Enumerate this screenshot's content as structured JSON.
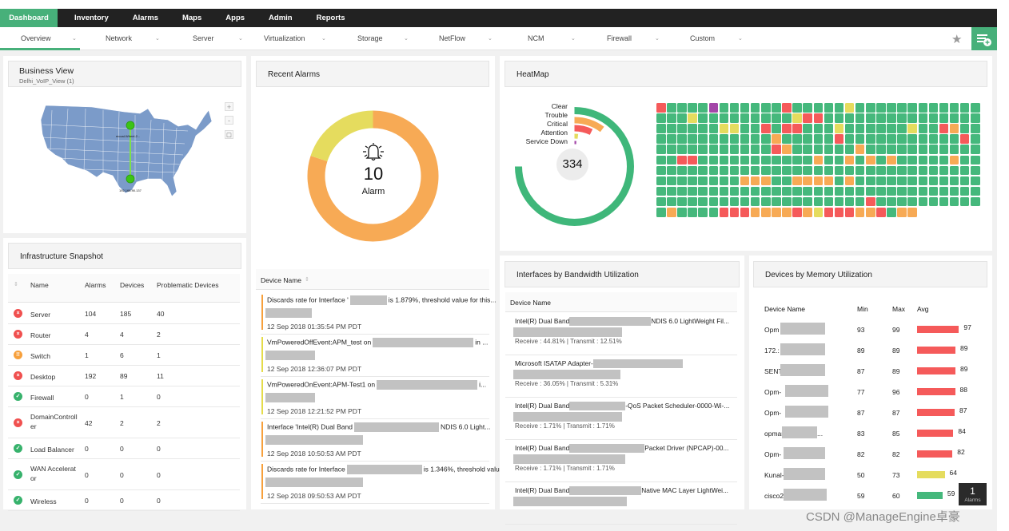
{
  "topnav": {
    "tabs": [
      {
        "label": "Dashboard",
        "active": true
      },
      {
        "label": "Inventory"
      },
      {
        "label": "Alarms"
      },
      {
        "label": "Maps"
      },
      {
        "label": "Apps"
      },
      {
        "label": "Admin"
      },
      {
        "label": "Reports"
      }
    ]
  },
  "subnav": {
    "items": [
      "Overview",
      "Network",
      "Server",
      "Virtualization",
      "Storage",
      "NetFlow",
      "NCM",
      "Firewall",
      "Custom"
    ],
    "active": "Overview",
    "star_icon": "star-icon",
    "add_widget_icon": "add-widget-icon"
  },
  "business_view": {
    "title": "Business View",
    "subtitle": "Delhi_VoIP_View (1)",
    "map_controls": [
      "+",
      "-",
      "□"
    ],
    "node_labels": [
      "mcoal-Wheel-2...",
      "192.168.90.137"
    ],
    "colors": {
      "map": "#7a9cc8",
      "node": "#3cc416",
      "link": "#7de04a"
    }
  },
  "infrastructure_snapshot": {
    "title": "Infrastructure Snapshot",
    "columns": [
      "Name",
      "Alarms",
      "Devices",
      "Problematic Devices"
    ],
    "rows": [
      {
        "status": "critical",
        "name": "Server",
        "alarms": "104",
        "devices": "185",
        "problematic": "40"
      },
      {
        "status": "critical",
        "name": "Router",
        "alarms": "4",
        "devices": "4",
        "problematic": "2"
      },
      {
        "status": "warning",
        "name": "Switch",
        "alarms": "1",
        "devices": "6",
        "problematic": "1"
      },
      {
        "status": "critical",
        "name": "Desktop",
        "alarms": "192",
        "devices": "89",
        "problematic": "11"
      },
      {
        "status": "ok",
        "name": "Firewall",
        "alarms": "0",
        "devices": "1",
        "problematic": "0"
      },
      {
        "status": "critical",
        "name": "DomainController",
        "alarms": "42",
        "devices": "2",
        "problematic": "2"
      },
      {
        "status": "ok",
        "name": "Load Balancer",
        "alarms": "0",
        "devices": "0",
        "problematic": "0"
      },
      {
        "status": "ok",
        "name": "WAN Accelerator",
        "alarms": "0",
        "devices": "0",
        "problematic": "0"
      },
      {
        "status": "ok",
        "name": "Wireless",
        "alarms": "0",
        "devices": "0",
        "problematic": "0"
      }
    ],
    "status_colors": {
      "critical": "#f0504f",
      "warning": "#f7a03c",
      "ok": "#37b26c"
    }
  },
  "recent_alarms": {
    "title": "Recent Alarms",
    "count": "10",
    "count_label": "Alarm",
    "donut": [
      {
        "severity": "Trouble",
        "value": 8,
        "color": "#f7aa55"
      },
      {
        "severity": "Attention",
        "value": 2,
        "color": "#e5dc5e"
      }
    ],
    "list_header": "Device Name",
    "items": [
      {
        "pre": "Discards rate for Interface '",
        "post": "is 1.879%, threshold value for this...",
        "time": "12 Sep 2018 01:35:54 PM PDT",
        "color": "#f7a03c"
      },
      {
        "pre": "VmPoweredOffEvent:APM_test on",
        "post": "in ...",
        "time": "12 Sep 2018 12:36:07 PM PDT",
        "color": "#e5dc4a"
      },
      {
        "pre": "VmPoweredOnEvent:APM-Test1 on",
        "post": "i...",
        "time": "12 Sep 2018 12:21:52 PM PDT",
        "color": "#e5dc4a"
      },
      {
        "pre": "Interface 'Intel(R) Dual Band",
        "post": "NDIS 6.0 Light...",
        "time": "12 Sep 2018 10:50:53 AM PDT",
        "color": "#f7a03c"
      },
      {
        "pre": "Discards rate for Interface",
        "post": "is 1.346%, threshold value for...",
        "time": "12 Sep 2018 09:50:53 AM PDT",
        "color": "#f7a03c"
      }
    ]
  },
  "heatmap": {
    "title": "HeatMap",
    "total": "334",
    "legend": [
      {
        "label": "Clear",
        "color": "#3fb77a"
      },
      {
        "label": "Trouble",
        "color": "#f7aa55"
      },
      {
        "label": "Critical",
        "color": "#f55a5a"
      },
      {
        "label": "Attention",
        "color": "#e5dc5e"
      },
      {
        "label": "Service Down",
        "color": "#a347a8"
      }
    ],
    "radial_fractions": {
      "Clear": 0.84,
      "Trouble": 0.085,
      "Critical": 0.06,
      "Attention": 0.015,
      "Service Down": 0.005
    },
    "grid_rows": [
      "RGGGGPGGGGGGRGGGGGYGGGGGGGGGGGG",
      "GGGYGGGGGGGGGYRRGGGGGGGGGGGGGGG",
      "GGGGGGYYGGRGRRGGGYGGGGGGYGGROGG",
      "GGGGGGGGGGGOGGGGGRGGGGGGGGGGGRG",
      "GGGGGGGGGGGROGGGGGGOGGGGGGGGGGG",
      "GGRRGGGGGGGGGGGOGGOGOGOGGGGGOGG",
      "GGGGGGGGGGGGGGGGGGGGGGGGGGGGGGG",
      "GGGGGGGGOOOGGOOOOGOGGGGGGGGGGGG",
      "GGGGGGGGGGGGGGGGGGGGGGGGGGGGGGG",
      "GGGGGGGGGGGGGGGGGGGGRGGGGGGGGGG",
      "GOGGGGRRROOOOROYRRROORGOO"
    ],
    "cell_colors": {
      "G": "#45b87c",
      "R": "#f55a5a",
      "O": "#f7aa55",
      "Y": "#e5dc5e",
      "P": "#a347a8"
    }
  },
  "bandwidth": {
    "title": "Interfaces by Bandwidth Utilization",
    "list_header": "Device Name",
    "items": [
      {
        "pre": "Intel(R) Dual Band",
        "post": "NDIS 6.0 LightWeight Fil...",
        "stats": "Receive : 44.81% | Transmit : 12.51%"
      },
      {
        "pre": "Microsoft ISATAP Adapter-",
        "post": "",
        "stats": "Receive : 36.05% | Transmit : 5.31%"
      },
      {
        "pre": "Intel(R) Dual Band",
        "post": "-QoS Packet Scheduler-0000-Wi-...",
        "stats": "Receive : 1.71% | Transmit : 1.71%"
      },
      {
        "pre": "Intel(R) Dual Band",
        "post": "Packet Driver (NPCAP)-00...",
        "stats": "Receive : 1.71% | Transmit : 1.71%"
      },
      {
        "pre": "Intel(R) Dual Band",
        "post": "Native MAC Layer LightWei...",
        "stats": ""
      }
    ]
  },
  "memory": {
    "title": "Devices by Memory Utilization",
    "columns": [
      "Device Name",
      "Min",
      "Max",
      "Avg"
    ],
    "rows": [
      {
        "name": "Opm",
        "suffix": "",
        "min": "93",
        "max": "99",
        "avg": 97,
        "color": "#f55a5a"
      },
      {
        "name": "172.:",
        "suffix": "",
        "min": "89",
        "max": "89",
        "avg": 89,
        "color": "#f55a5a"
      },
      {
        "name": "SENT",
        "suffix": "",
        "min": "87",
        "max": "89",
        "avg": 89,
        "color": "#f55a5a"
      },
      {
        "name": "Opm-",
        "suffix": "",
        "min": "77",
        "max": "96",
        "avg": 88,
        "color": "#f55a5a"
      },
      {
        "name": "Opm-",
        "suffix": "",
        "min": "87",
        "max": "87",
        "avg": 87,
        "color": "#f55a5a"
      },
      {
        "name": "opmar",
        "suffix": "...",
        "min": "83",
        "max": "85",
        "avg": 84,
        "color": "#f55a5a"
      },
      {
        "name": "Opm-",
        "suffix": "",
        "min": "82",
        "max": "82",
        "avg": 82,
        "color": "#f55a5a"
      },
      {
        "name": "Kunal-",
        "suffix": "",
        "min": "50",
        "max": "73",
        "avg": 64,
        "color": "#e5dc5e"
      },
      {
        "name": "cisco2",
        "suffix": "",
        "min": "59",
        "max": "60",
        "avg": 59,
        "color": "#45b87c"
      }
    ]
  },
  "alarms_badge": {
    "count": "1",
    "label": "Alarms"
  },
  "watermark": "CSDN @ManageEngine卓豪"
}
